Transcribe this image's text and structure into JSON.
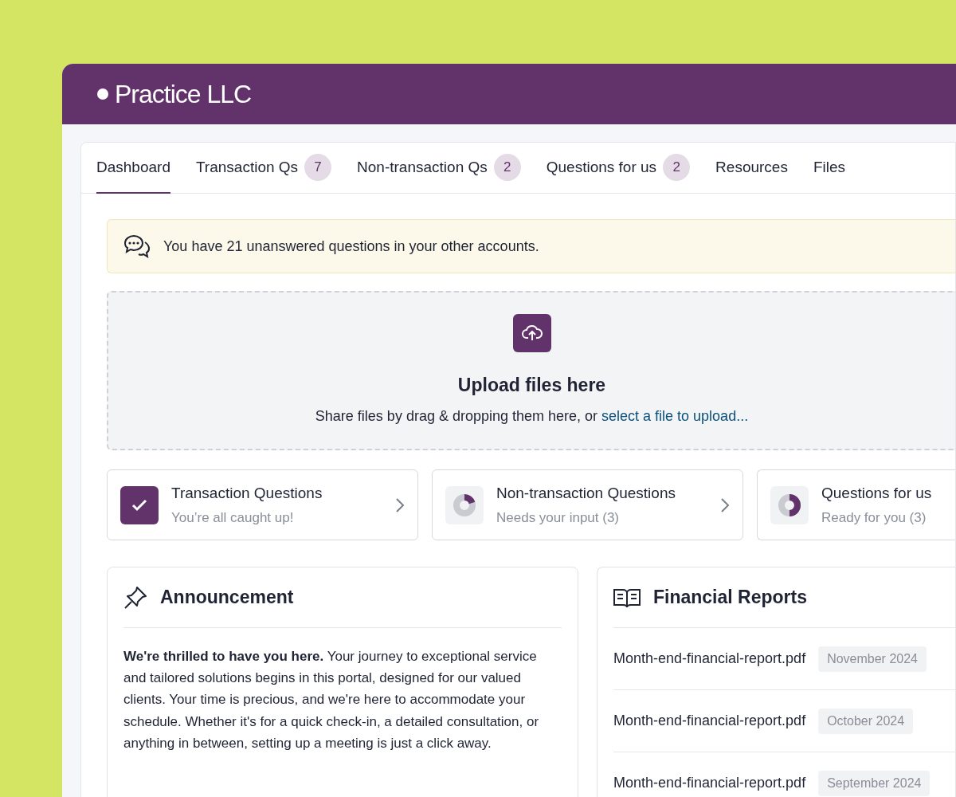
{
  "brand": {
    "name": "Practice LLC"
  },
  "tabs": [
    {
      "label": "Dashboard",
      "selected": true
    },
    {
      "label": "Transaction Qs",
      "count": "7",
      "selected": false
    },
    {
      "label": "Non-transaction Qs",
      "count": "2",
      "selected": false
    },
    {
      "label": "Questions for us",
      "count": "2",
      "selected": false
    },
    {
      "label": "Resources",
      "selected": false
    },
    {
      "label": "Files",
      "selected": false
    }
  ],
  "alert": {
    "text": "You have 21 unanswered questions in your other accounts."
  },
  "upload": {
    "title": "Upload files here",
    "text": "Share files by drag & dropping them here, or",
    "link": "select a file to upload..."
  },
  "status_cards": [
    {
      "kind": "done",
      "title": "Transaction Questions",
      "subtitle": "You’re all caught up!",
      "chevron": true
    },
    {
      "kind": "progress",
      "level": 0.2,
      "title": "Non-transaction Questions",
      "subtitle": "Needs your input (3)",
      "chevron": true
    },
    {
      "kind": "progress",
      "level": 0.5,
      "title": "Questions for us",
      "subtitle": "Ready for you (3)",
      "chevron": false
    }
  ],
  "announcement": {
    "title": "Announcement",
    "text": "**We're thrilled to have you here.** Your journey to exceptional service and tailored solutions begins in this portal, designed for our valued clients. Your time is precious, and we're here to accommodate your schedule. Whether it's for a quick check-in, a detailed consultation, or anything in between, setting up a meeting is just a click away."
  },
  "financial_reports": {
    "title": "Financial Reports",
    "rows": [
      {
        "file": "Month-end-financial-report.pdf",
        "date": "November 2024"
      },
      {
        "file": "Month-end-financial-report.pdf",
        "date": "October 2024"
      },
      {
        "file": "Month-end-financial-report.pdf",
        "date": "September 2024"
      }
    ]
  }
}
